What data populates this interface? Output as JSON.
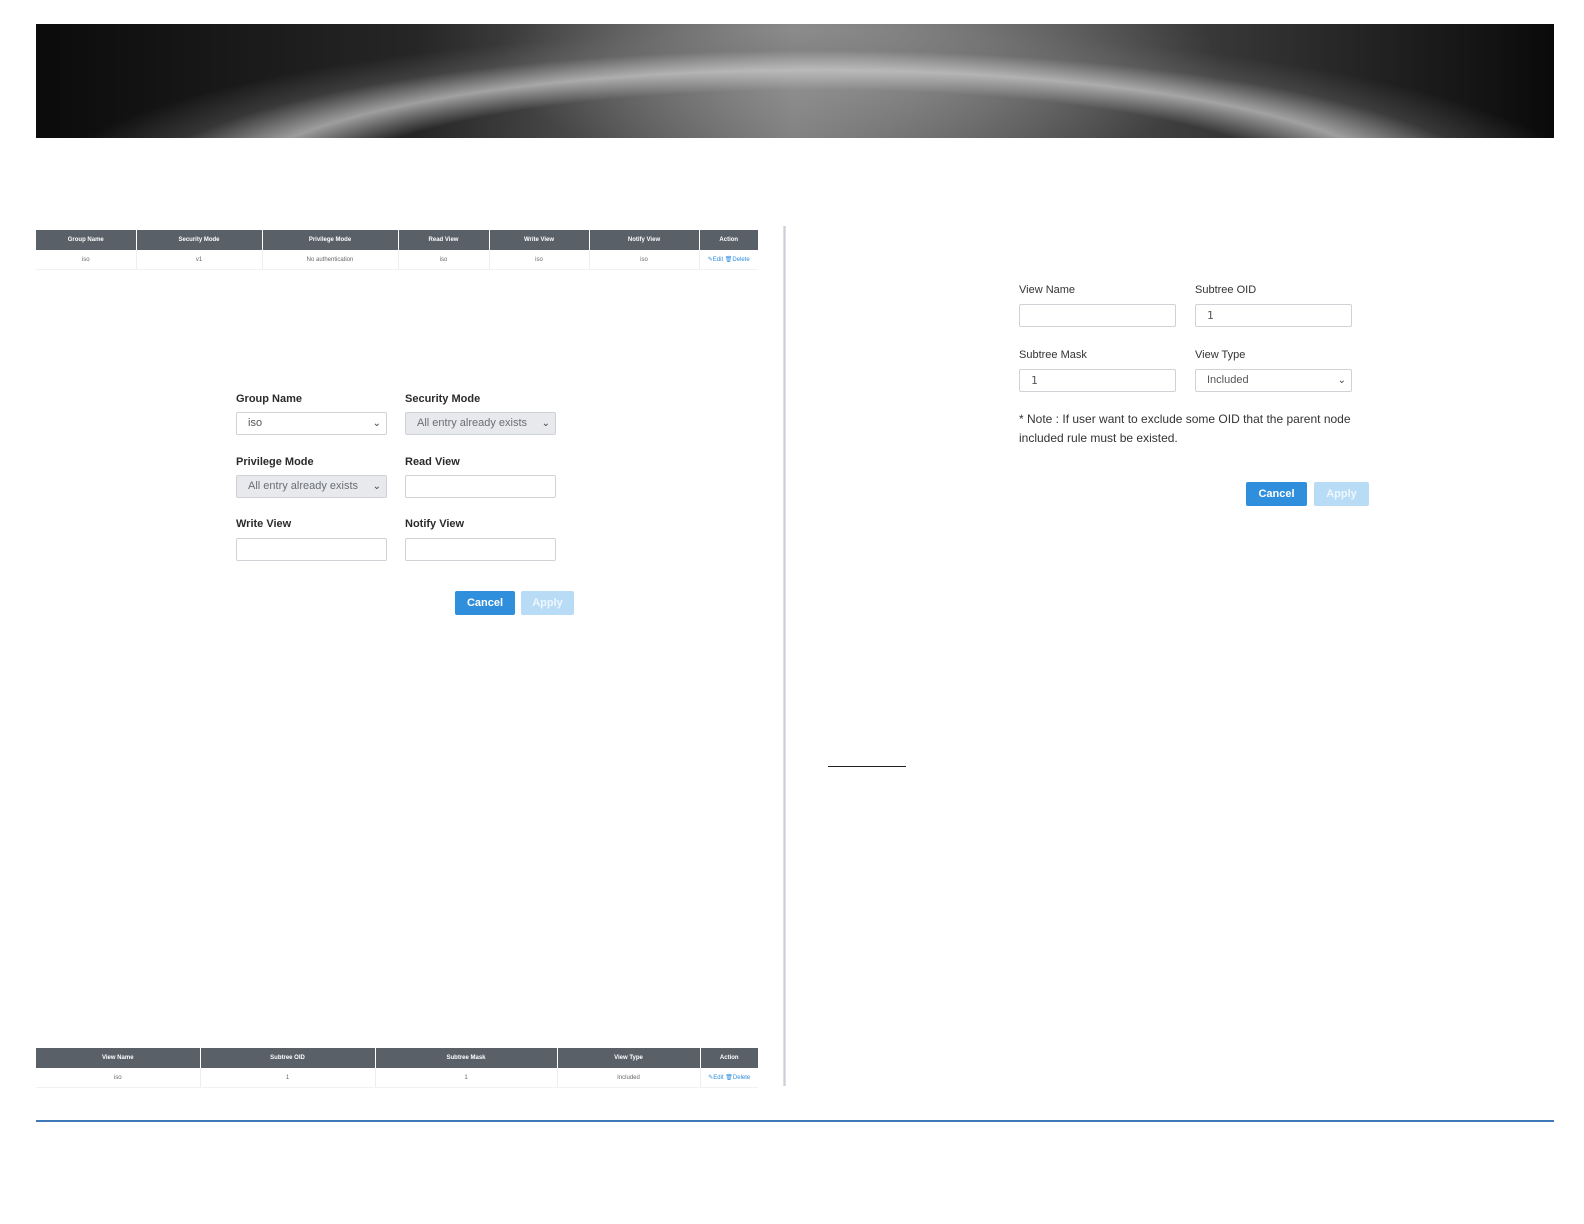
{
  "group_table": {
    "headers": [
      "Group Name",
      "Security Mode",
      "Privilege Mode",
      "Read View",
      "Write View",
      "Notify View",
      "Action"
    ],
    "row": [
      "iso",
      "v1",
      "No authentication",
      "iso",
      "iso",
      "iso"
    ],
    "edit_label": "Edit",
    "delete_label": "Delete"
  },
  "group_form": {
    "group_name_label": "Group Name",
    "group_name_value": "iso",
    "security_mode_label": "Security Mode",
    "security_mode_value": "All entry already exists",
    "privilege_mode_label": "Privilege Mode",
    "privilege_mode_value": "All entry already exists",
    "read_view_label": "Read View",
    "read_view_value": "",
    "write_view_label": "Write View",
    "write_view_value": "",
    "notify_view_label": "Notify View",
    "notify_view_value": "",
    "cancel_label": "Cancel",
    "apply_label": "Apply"
  },
  "view_form": {
    "view_name_label": "View Name",
    "view_name_value": "",
    "subtree_oid_label": "Subtree OID",
    "subtree_oid_value": "1",
    "subtree_mask_label": "Subtree Mask",
    "subtree_mask_value": "1",
    "view_type_label": "View Type",
    "view_type_value": "Included",
    "note": "* Note : If user want to exclude some OID that the parent node included rule must be existed.",
    "cancel_label": "Cancel",
    "apply_label": "Apply"
  },
  "view_table": {
    "headers": [
      "View Name",
      "Subtree OID",
      "Subtree Mask",
      "View Type",
      "Action"
    ],
    "row": [
      "iso",
      "1",
      "1",
      "Included"
    ],
    "edit_label": "Edit",
    "delete_label": "Delete"
  },
  "icons": {
    "select_caret": "chevron-down-icon",
    "edit": "edit-icon",
    "delete": "trash-icon"
  },
  "colors": {
    "header_bg": "#5a6068",
    "primary": "#2f8fdd",
    "apply_disabled": "#b8dcf6",
    "rule": "#3f78b6"
  }
}
